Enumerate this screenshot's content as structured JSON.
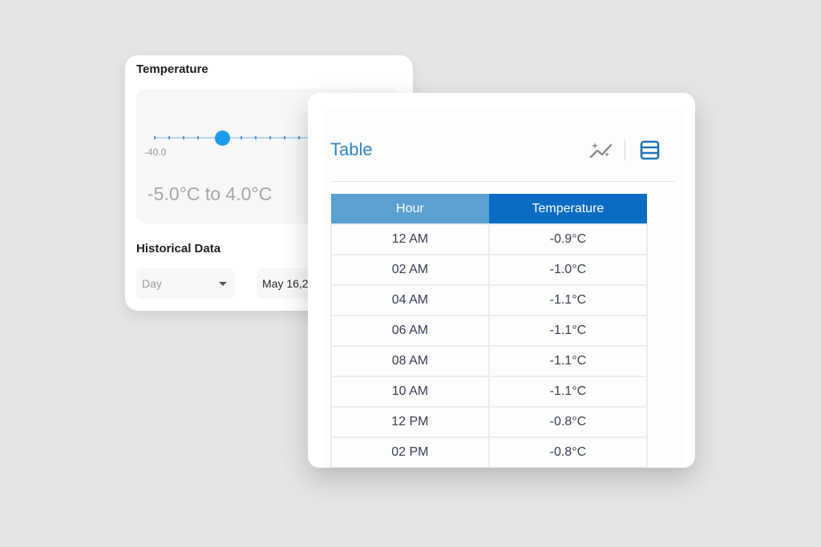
{
  "temperature_panel": {
    "title": "Temperature",
    "slider_min": "-40.0",
    "range_text": "-5.0°C to 4.0°C"
  },
  "historical": {
    "title": "Historical Data",
    "period_value": "Day",
    "date_value": "May 16,2"
  },
  "table_panel": {
    "title": "Table",
    "columns": [
      "Hour",
      "Temperature"
    ],
    "rows": [
      [
        "12 AM",
        "-0.9°C"
      ],
      [
        "02 AM",
        "-1.0°C"
      ],
      [
        "04 AM",
        "-1.1°C"
      ],
      [
        "06 AM",
        "-1.1°C"
      ],
      [
        "08 AM",
        "-1.1°C"
      ],
      [
        "10 AM",
        "-1.1°C"
      ],
      [
        "12 PM",
        "-0.8°C"
      ],
      [
        "02 PM",
        "-0.8°C"
      ]
    ]
  },
  "icons": {
    "chart_view": "line-chart-sparkle-icon",
    "table_view": "table-icon"
  },
  "colors": {
    "accent": "#2f8ac4",
    "header_light": "#5aa0d2",
    "header_dark": "#0a6cc3",
    "slider_thumb": "#1d9be8"
  }
}
